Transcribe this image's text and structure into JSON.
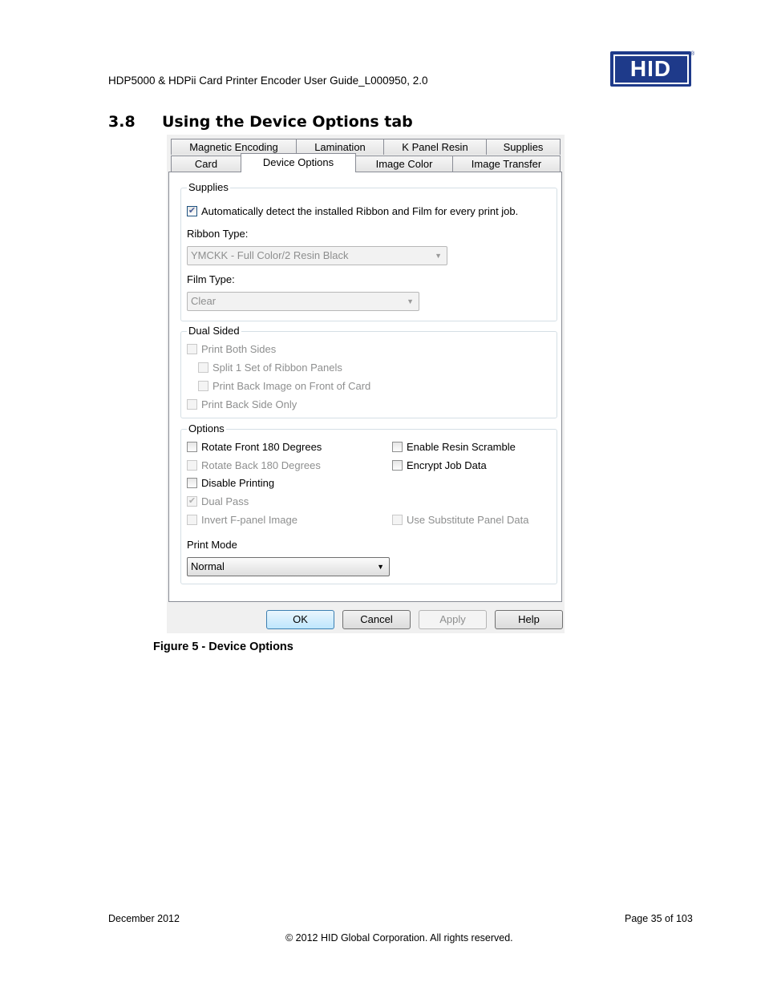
{
  "header": {
    "doc_title": "HDP5000 & HDPii Card Printer Encoder User Guide_L000950, 2.0",
    "logo_text": "HID",
    "logo_mark": "®"
  },
  "section": {
    "number": "3.8",
    "title": "Using the Device Options tab"
  },
  "dialog": {
    "tabs_row1": [
      "Magnetic Encoding",
      "Lamination",
      "K Panel Resin",
      "Supplies"
    ],
    "tabs_row2": [
      "Card",
      "Device Options",
      "Image Color",
      "Image Transfer"
    ],
    "active_tab": "Device Options",
    "supplies": {
      "label": "Supplies",
      "auto_detect_label": "Automatically detect the installed Ribbon and Film for every print job.",
      "auto_detect_checked": true,
      "ribbon_type_label": "Ribbon Type:",
      "ribbon_type_value": "YMCKK - Full Color/2 Resin Black",
      "film_type_label": "Film Type:",
      "film_type_value": "Clear"
    },
    "dual_sided": {
      "label": "Dual Sided",
      "print_both_sides": "Print Both Sides",
      "split_ribbon": "Split 1 Set of Ribbon Panels",
      "print_back_on_front": "Print Back Image on Front of Card",
      "print_back_only": "Print Back Side Only"
    },
    "options": {
      "label": "Options",
      "rotate_front": "Rotate Front 180 Degrees",
      "rotate_back": "Rotate Back 180 Degrees",
      "disable_printing": "Disable Printing",
      "dual_pass": "Dual Pass",
      "invert_fpanel": "Invert F-panel Image",
      "enable_resin_scramble": "Enable Resin Scramble",
      "encrypt_job_data": "Encrypt Job Data",
      "use_substitute_panel": "Use Substitute Panel Data",
      "print_mode_label": "Print Mode",
      "print_mode_value": "Normal"
    },
    "buttons": {
      "ok": "OK",
      "cancel": "Cancel",
      "apply": "Apply",
      "help": "Help"
    }
  },
  "caption": "Figure 5 - Device Options",
  "footer": {
    "date": "December 2012",
    "page": "Page 35 of 103",
    "copyright": "© 2012 HID Global Corporation. All rights reserved."
  }
}
